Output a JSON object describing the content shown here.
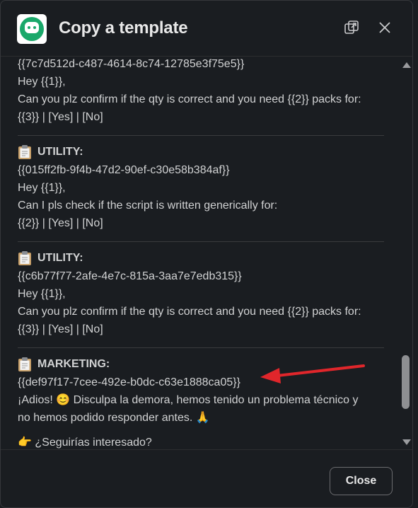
{
  "header": {
    "title": "Copy a template",
    "popout_icon": "popout-icon",
    "close_icon": "close-icon"
  },
  "templates": [
    {
      "id_line": "{{7c7d512d-c487-4614-8c74-12785e3f75e5}}",
      "lines": [
        "Hey {{1}},",
        "Can you plz confirm if the qty is correct and you need {{2}} packs for:",
        "{{3}} | [Yes] | [No]"
      ]
    },
    {
      "category": "UTILITY:",
      "id_line": "{{015ff2fb-9f4b-47d2-90ef-c30e58b384af}}",
      "lines": [
        "Hey {{1}},",
        "Can I pls check if the script is written generically for:",
        "{{2}} | [Yes] | [No]"
      ]
    },
    {
      "category": "UTILITY:",
      "id_line": "{{c6b77f77-2afe-4e7c-815a-3aa7e7edb315}}",
      "lines": [
        "Hey {{1}},",
        "Can you plz confirm if the qty is correct and you need {{2}} packs for:",
        "{{3}} | [Yes] | [No]"
      ]
    },
    {
      "category": "MARKETING:",
      "id_line": "{{def97f17-7cee-492e-b0dc-c63e1888ca05}}",
      "lines": [
        "¡Adios! 😊 Disculpa la demora, hemos tenido un problema técnico y",
        "no hemos podido responder antes. 🙏",
        "👉 ¿Seguirías interesado?"
      ]
    }
  ],
  "footer": {
    "close_label": "Close"
  },
  "colors": {
    "background": "#1a1d21",
    "text": "#d1d2d3",
    "annotation_arrow": "#e0262b"
  }
}
